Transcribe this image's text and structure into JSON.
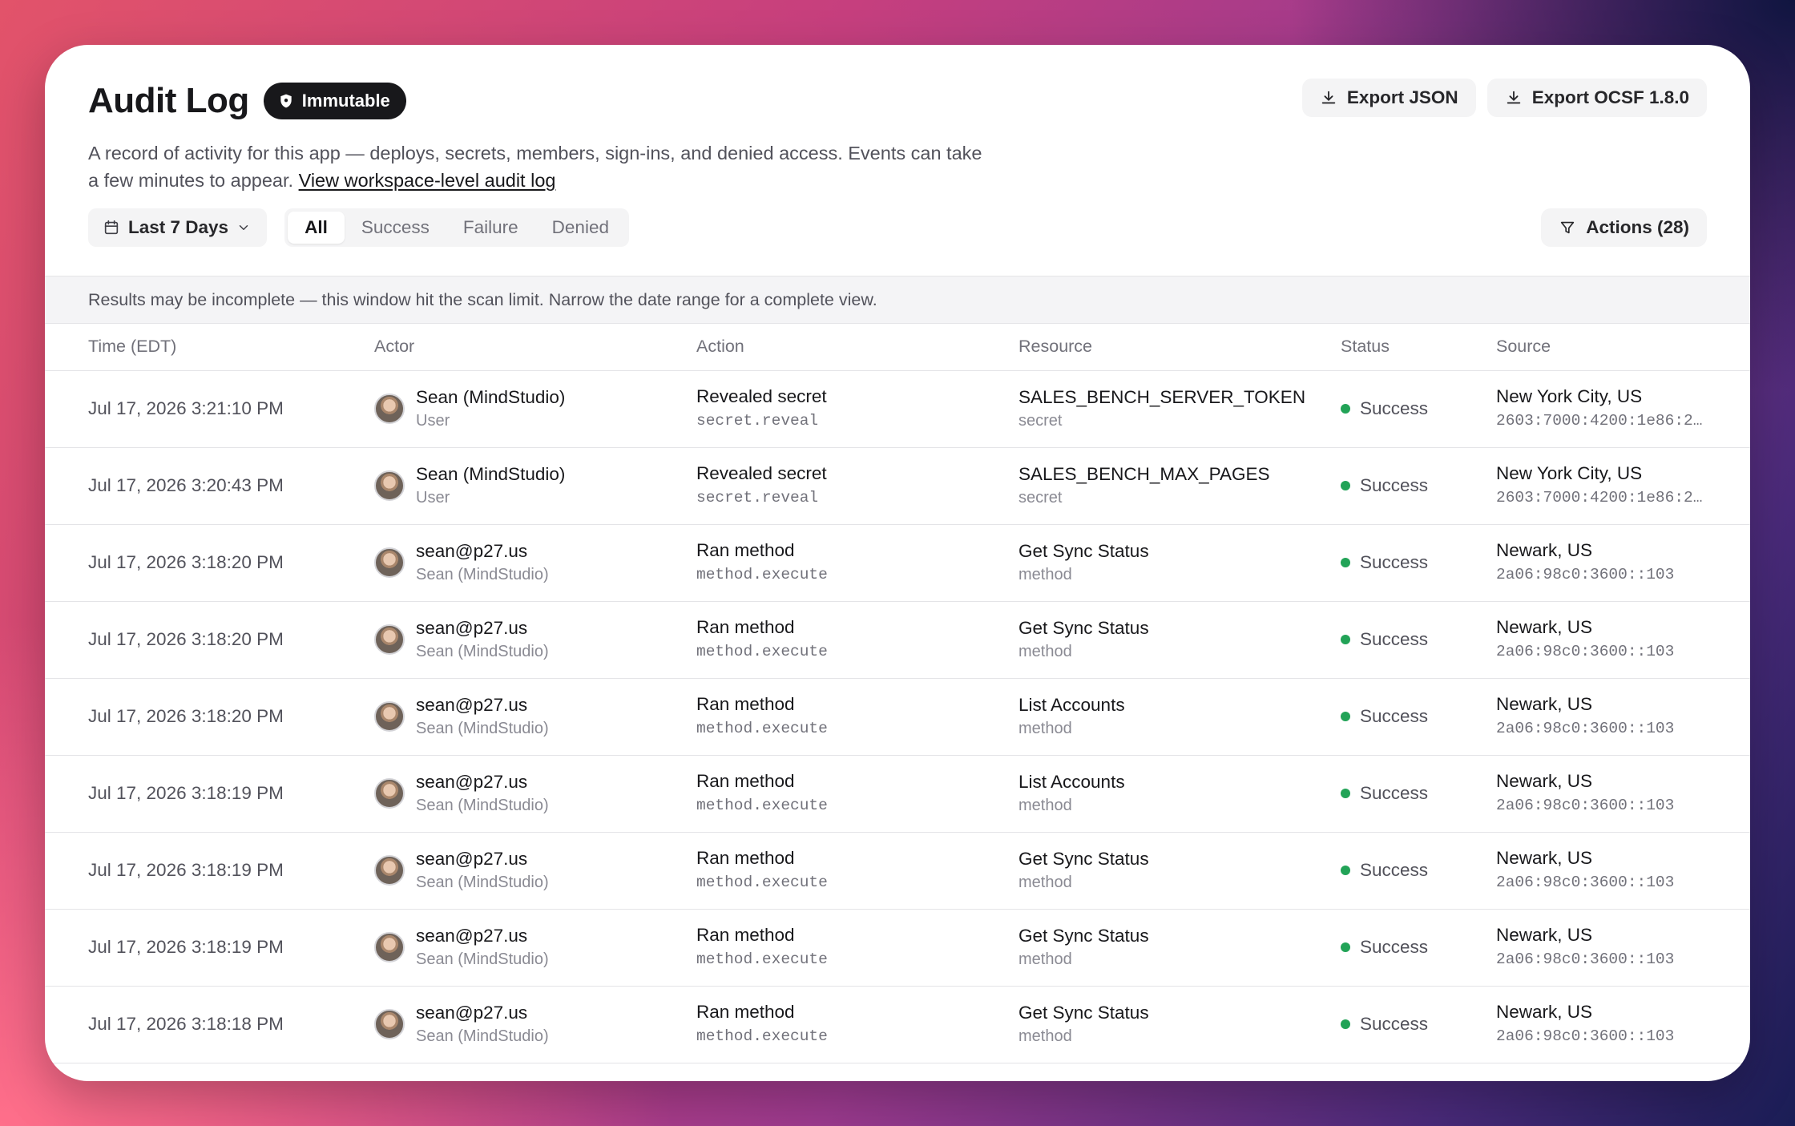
{
  "header": {
    "title": "Audit Log",
    "badge": "Immutable",
    "description": "A record of activity for this app — deploys, secrets, members, sign-ins, and denied access. Events can take a few minutes to appear.",
    "link": "View workspace-level audit log",
    "export_json": "Export JSON",
    "export_ocsf": "Export OCSF 1.8.0"
  },
  "filters": {
    "date_range": "Last 7 Days",
    "tabs": [
      "All",
      "Success",
      "Failure",
      "Denied"
    ],
    "active_tab": "All",
    "actions_filter": "Actions (28)"
  },
  "notice": "Results may be incomplete — this window hit the scan limit. Narrow the date range for a complete view.",
  "table": {
    "columns": [
      "Time (EDT)",
      "Actor",
      "Action",
      "Resource",
      "Status",
      "Source"
    ],
    "rows": [
      {
        "time": "Jul 17, 2026 3:21:10 PM",
        "actor": "Sean (MindStudio)",
        "actor_sub": "User",
        "action": "Revealed secret",
        "action_code": "secret.reveal",
        "resource": "SALES_BENCH_SERVER_TOKEN",
        "resource_type": "secret",
        "status": "Success",
        "location": "New York City, US",
        "ip": "2603:7000:4200:1e86:2…"
      },
      {
        "time": "Jul 17, 2026 3:20:43 PM",
        "actor": "Sean (MindStudio)",
        "actor_sub": "User",
        "action": "Revealed secret",
        "action_code": "secret.reveal",
        "resource": "SALES_BENCH_MAX_PAGES",
        "resource_type": "secret",
        "status": "Success",
        "location": "New York City, US",
        "ip": "2603:7000:4200:1e86:2…"
      },
      {
        "time": "Jul 17, 2026 3:18:20 PM",
        "actor": "sean@p27.us",
        "actor_sub": "Sean (MindStudio)",
        "action": "Ran method",
        "action_code": "method.execute",
        "resource": "Get Sync Status",
        "resource_type": "method",
        "status": "Success",
        "location": "Newark, US",
        "ip": "2a06:98c0:3600::103"
      },
      {
        "time": "Jul 17, 2026 3:18:20 PM",
        "actor": "sean@p27.us",
        "actor_sub": "Sean (MindStudio)",
        "action": "Ran method",
        "action_code": "method.execute",
        "resource": "Get Sync Status",
        "resource_type": "method",
        "status": "Success",
        "location": "Newark, US",
        "ip": "2a06:98c0:3600::103"
      },
      {
        "time": "Jul 17, 2026 3:18:20 PM",
        "actor": "sean@p27.us",
        "actor_sub": "Sean (MindStudio)",
        "action": "Ran method",
        "action_code": "method.execute",
        "resource": "List Accounts",
        "resource_type": "method",
        "status": "Success",
        "location": "Newark, US",
        "ip": "2a06:98c0:3600::103"
      },
      {
        "time": "Jul 17, 2026 3:18:19 PM",
        "actor": "sean@p27.us",
        "actor_sub": "Sean (MindStudio)",
        "action": "Ran method",
        "action_code": "method.execute",
        "resource": "List Accounts",
        "resource_type": "method",
        "status": "Success",
        "location": "Newark, US",
        "ip": "2a06:98c0:3600::103"
      },
      {
        "time": "Jul 17, 2026 3:18:19 PM",
        "actor": "sean@p27.us",
        "actor_sub": "Sean (MindStudio)",
        "action": "Ran method",
        "action_code": "method.execute",
        "resource": "Get Sync Status",
        "resource_type": "method",
        "status": "Success",
        "location": "Newark, US",
        "ip": "2a06:98c0:3600::103"
      },
      {
        "time": "Jul 17, 2026 3:18:19 PM",
        "actor": "sean@p27.us",
        "actor_sub": "Sean (MindStudio)",
        "action": "Ran method",
        "action_code": "method.execute",
        "resource": "Get Sync Status",
        "resource_type": "method",
        "status": "Success",
        "location": "Newark, US",
        "ip": "2a06:98c0:3600::103"
      },
      {
        "time": "Jul 17, 2026 3:18:18 PM",
        "actor": "sean@p27.us",
        "actor_sub": "Sean (MindStudio)",
        "action": "Ran method",
        "action_code": "method.execute",
        "resource": "Get Sync Status",
        "resource_type": "method",
        "status": "Success",
        "location": "Newark, US",
        "ip": "2a06:98c0:3600::103"
      }
    ]
  },
  "colors": {
    "success_dot": "#22a357",
    "badge_bg": "#18181b"
  },
  "icons": {
    "badge": "shield-icon",
    "export": "download-icon",
    "date": "calendar-icon",
    "dropdown": "chevron-down-icon",
    "actions": "filter-icon"
  }
}
